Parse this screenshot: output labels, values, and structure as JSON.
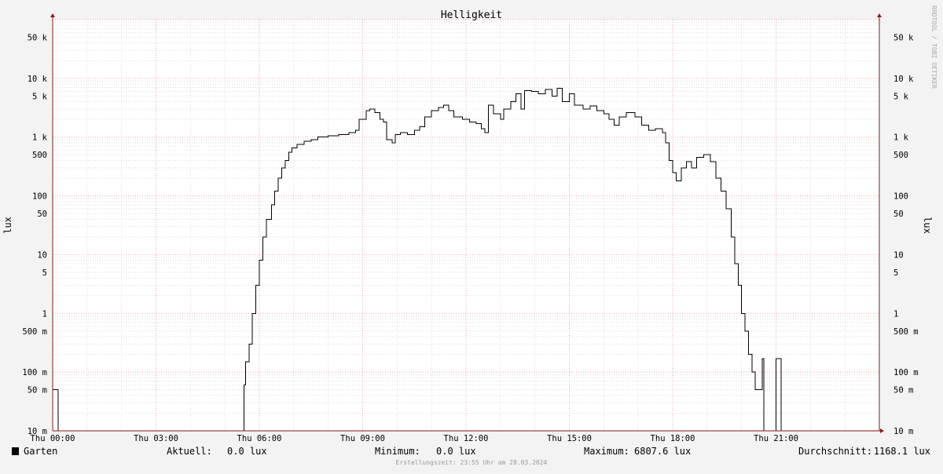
{
  "chart_data": {
    "type": "line",
    "title": "Helligkeit",
    "ylabel": "lux",
    "y_scale": "log",
    "ylim": [
      0.01,
      100000
    ],
    "xlim": [
      0,
      24
    ],
    "x_tick_labels": [
      "Thu 00:00",
      "Thu 03:00",
      "Thu 06:00",
      "Thu 09:00",
      "Thu 12:00",
      "Thu 15:00",
      "Thu 18:00",
      "Thu 21:00"
    ],
    "y_ticks": [
      {
        "value": 0.01,
        "label": "10 m"
      },
      {
        "value": 0.05,
        "label": "50 m"
      },
      {
        "value": 0.1,
        "label": "100 m"
      },
      {
        "value": 0.5,
        "label": "500 m"
      },
      {
        "value": 1,
        "label": "1"
      },
      {
        "value": 5,
        "label": "5"
      },
      {
        "value": 10,
        "label": "10"
      },
      {
        "value": 50,
        "label": "50"
      },
      {
        "value": 100,
        "label": "100"
      },
      {
        "value": 500,
        "label": "500"
      },
      {
        "value": 1000,
        "label": "1 k"
      },
      {
        "value": 5000,
        "label": "5 k"
      },
      {
        "value": 10000,
        "label": "10 k"
      },
      {
        "value": 50000,
        "label": "50 k"
      }
    ],
    "grid": true,
    "series": [
      {
        "name": "Garten",
        "color": "#000000",
        "x_unit": "hour of day",
        "points": [
          [
            0.0,
            0.05
          ],
          [
            0.15,
            0.05
          ],
          [
            0.16,
            0.01
          ],
          [
            5.5,
            0.01
          ],
          [
            5.55,
            0.06
          ],
          [
            5.6,
            0.15
          ],
          [
            5.7,
            0.3
          ],
          [
            5.8,
            1.0
          ],
          [
            5.9,
            3.0
          ],
          [
            6.0,
            8.0
          ],
          [
            6.1,
            20
          ],
          [
            6.2,
            40
          ],
          [
            6.35,
            70
          ],
          [
            6.45,
            120
          ],
          [
            6.55,
            200
          ],
          [
            6.65,
            300
          ],
          [
            6.75,
            400
          ],
          [
            6.85,
            550
          ],
          [
            6.95,
            650
          ],
          [
            7.1,
            750
          ],
          [
            7.3,
            850
          ],
          [
            7.5,
            900
          ],
          [
            7.7,
            1000
          ],
          [
            8.0,
            1050
          ],
          [
            8.3,
            1100
          ],
          [
            8.6,
            1200
          ],
          [
            8.8,
            1300
          ],
          [
            8.9,
            2000
          ],
          [
            9.1,
            2800
          ],
          [
            9.2,
            3000
          ],
          [
            9.35,
            2600
          ],
          [
            9.5,
            2000
          ],
          [
            9.6,
            1800
          ],
          [
            9.7,
            900
          ],
          [
            9.85,
            800
          ],
          [
            9.95,
            1100
          ],
          [
            10.1,
            1200
          ],
          [
            10.3,
            1100
          ],
          [
            10.5,
            1300
          ],
          [
            10.65,
            1500
          ],
          [
            10.8,
            2200
          ],
          [
            11.0,
            2800
          ],
          [
            11.2,
            3200
          ],
          [
            11.35,
            3500
          ],
          [
            11.5,
            2800
          ],
          [
            11.65,
            2200
          ],
          [
            11.9,
            2000
          ],
          [
            12.1,
            1800
          ],
          [
            12.3,
            1700
          ],
          [
            12.45,
            1400
          ],
          [
            12.55,
            1200
          ],
          [
            12.65,
            3500
          ],
          [
            12.8,
            2500
          ],
          [
            13.0,
            2000
          ],
          [
            13.1,
            3000
          ],
          [
            13.3,
            4000
          ],
          [
            13.45,
            5500
          ],
          [
            13.6,
            3000
          ],
          [
            13.7,
            6200
          ],
          [
            13.9,
            6000
          ],
          [
            14.1,
            5500
          ],
          [
            14.3,
            6500
          ],
          [
            14.5,
            5000
          ],
          [
            14.65,
            6800
          ],
          [
            14.8,
            4000
          ],
          [
            15.0,
            5500
          ],
          [
            15.15,
            3500
          ],
          [
            15.4,
            3000
          ],
          [
            15.6,
            3400
          ],
          [
            15.8,
            2800
          ],
          [
            16.0,
            2500
          ],
          [
            16.15,
            2000
          ],
          [
            16.3,
            1600
          ],
          [
            16.45,
            2200
          ],
          [
            16.65,
            2600
          ],
          [
            16.9,
            2200
          ],
          [
            17.1,
            1600
          ],
          [
            17.3,
            1300
          ],
          [
            17.5,
            1400
          ],
          [
            17.7,
            1200
          ],
          [
            17.8,
            800
          ],
          [
            17.9,
            400
          ],
          [
            18.0,
            250
          ],
          [
            18.1,
            180
          ],
          [
            18.25,
            300
          ],
          [
            18.4,
            380
          ],
          [
            18.55,
            300
          ],
          [
            18.7,
            450
          ],
          [
            18.9,
            500
          ],
          [
            19.1,
            380
          ],
          [
            19.25,
            200
          ],
          [
            19.4,
            120
          ],
          [
            19.55,
            60
          ],
          [
            19.7,
            20
          ],
          [
            19.8,
            7
          ],
          [
            19.9,
            3
          ],
          [
            20.0,
            1
          ],
          [
            20.1,
            0.5
          ],
          [
            20.2,
            0.2
          ],
          [
            20.3,
            0.1
          ],
          [
            20.4,
            0.05
          ],
          [
            20.55,
            0.05
          ],
          [
            20.6,
            0.17
          ],
          [
            20.65,
            0.01
          ],
          [
            20.95,
            0.01
          ],
          [
            21.0,
            0.17
          ],
          [
            21.1,
            0.17
          ],
          [
            21.15,
            0.01
          ],
          [
            24.0,
            0.01
          ]
        ]
      }
    ],
    "legend": {
      "series": "Garten",
      "stats": [
        {
          "label": "Aktuell:",
          "value": "0.0 lux"
        },
        {
          "label": "Minimum:",
          "value": "0.0 lux"
        },
        {
          "label": "Maximum:",
          "value": "6807.6 lux"
        },
        {
          "label": "Durchschnitt:",
          "value": "1168.1 lux"
        }
      ]
    },
    "side_text": "RRDTOOL / TOBI OETIKER",
    "footer": "Erstellungszeit: 23:55 Uhr am 28.03.2024"
  },
  "colors": {
    "background": "#f3f3f3",
    "canvas": "#ffffff",
    "major_grid": "#e8a9b4",
    "minor_grid": "#dddddd",
    "axis": "#8b1a1a",
    "line": "#000000"
  }
}
